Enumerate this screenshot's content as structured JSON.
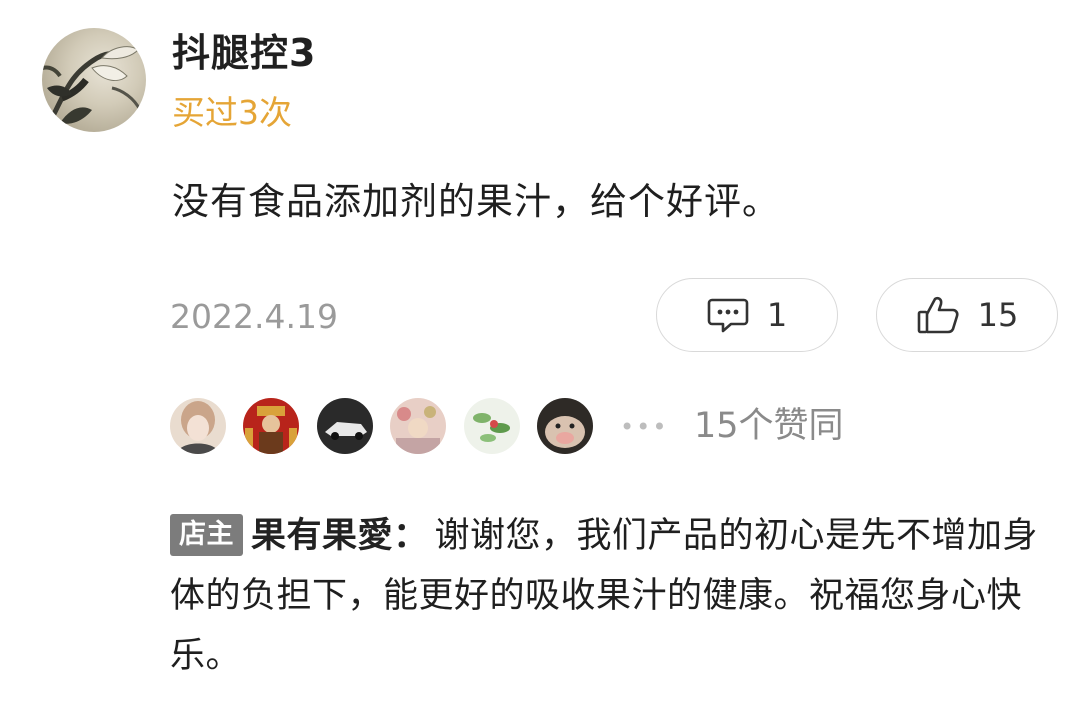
{
  "review": {
    "username": "抖腿控3",
    "purchase_badge": "买过3次",
    "content": "没有食品添加剂的果汁，给个好评。",
    "date": "2022.4.19",
    "comment_count": "1",
    "like_count": "15",
    "avatar_icon": "user-avatar-ink-painting"
  },
  "likers": {
    "avatars": [
      "liker-avatar-1",
      "liker-avatar-2",
      "liker-avatar-3",
      "liker-avatar-4",
      "liker-avatar-5",
      "liker-avatar-6"
    ],
    "more": "•••",
    "summary": "15个赞同"
  },
  "reply": {
    "badge": "店主",
    "shop_name": "果有果愛：",
    "text": "谢谢您，我们产品的初心是先不增加身体的负担下，能更好的吸收果汁的健康。祝福您身心快乐。"
  },
  "colors": {
    "purchase": "#e5a536",
    "date": "#9a9a9a",
    "badge_bg": "#7c7c7c",
    "pill_border": "#d9d9d9"
  }
}
